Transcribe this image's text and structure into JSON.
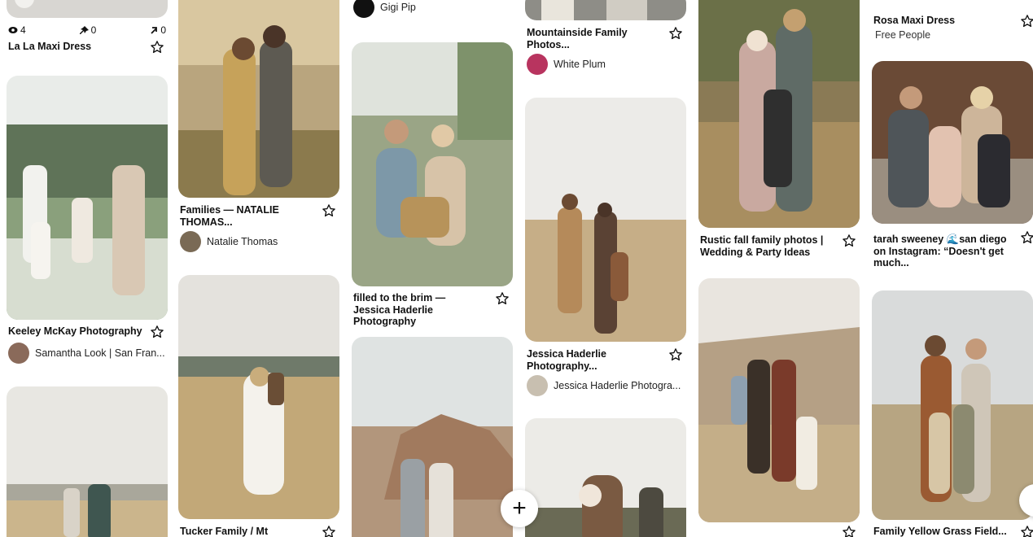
{
  "colors": {
    "text": "#111111",
    "subtext": "#333333",
    "tile_radius": "rounded",
    "background": "#ffffff"
  },
  "icons": {
    "save": "star-outline-icon",
    "views": "eye-icon",
    "saves": "pin-icon",
    "clicks": "arrow-up-right-icon",
    "create": "plus-icon"
  },
  "stats": {
    "views": "4",
    "saves": "0",
    "clicks": "0"
  },
  "pins": {
    "lala": {
      "title": "La La Maxi Dress"
    },
    "keeley": {
      "title": "Keeley McKay Photography",
      "author": "Samantha Look | San Fran..."
    },
    "families": {
      "title": "Families — NATALIE THOMAS...",
      "author": "Natalie Thomas"
    },
    "tucker": {
      "title": "Tucker Family / Mt"
    },
    "gigi": {
      "author": "Gigi Pip"
    },
    "brim": {
      "title": "filled to the brim — Jessica Haderlie Photography"
    },
    "mountainside": {
      "title": "Mountainside Family Photos...",
      "author": "White Plum"
    },
    "jessica": {
      "title": "Jessica Haderlie Photography...",
      "author": "Jessica Haderlie Photogra..."
    },
    "rustic": {
      "title": "Rustic fall family photos | Wedding & Party Ideas"
    },
    "rosa": {
      "title": "Rosa Maxi Dress",
      "sub": "Free People"
    },
    "tarah": {
      "title": "tarah sweeney 🌊san diego on Instagram: “Doesn't get much..."
    },
    "yellow": {
      "title": "Family Yellow Grass Field..."
    }
  },
  "fab": {
    "label": "+"
  }
}
